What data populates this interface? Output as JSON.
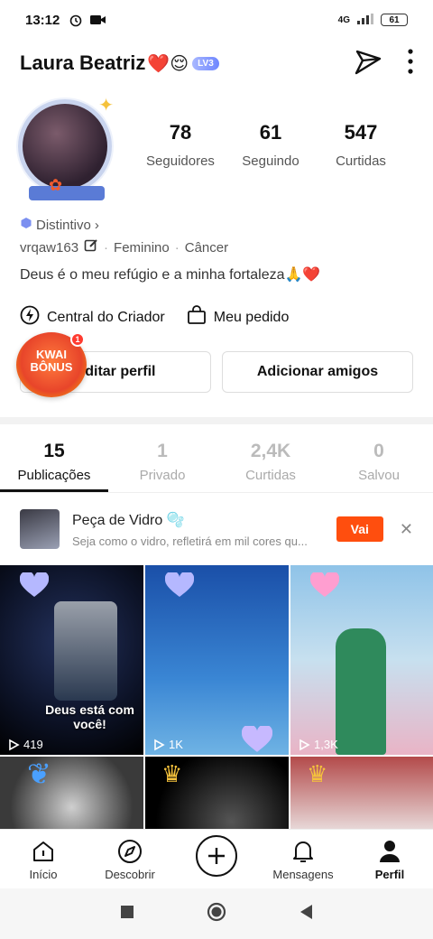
{
  "status": {
    "time": "13:12",
    "network": "4G",
    "battery": "61"
  },
  "header": {
    "name": "Laura Beatriz",
    "name_emoji": "❤️😌",
    "level": "LV3"
  },
  "stats": [
    {
      "value": "78",
      "label": "Seguidores"
    },
    {
      "value": "61",
      "label": "Seguindo"
    },
    {
      "value": "547",
      "label": "Curtidas"
    }
  ],
  "profile": {
    "badge_label": "Distintivo",
    "user_id": "vrqaw163",
    "gender": "Feminino",
    "sign": "Câncer",
    "bio": "Deus é o meu refúgio e a minha fortaleza🙏❤️"
  },
  "links": {
    "creator_center": "Central do Criador",
    "my_order": "Meu pedido"
  },
  "buttons": {
    "edit_profile": "Editar perfil",
    "add_friends": "Adicionar amigos"
  },
  "kwai_bonus": {
    "line1": "KWAI",
    "line2": "BÔNUS",
    "count": "1"
  },
  "tabs": [
    {
      "value": "15",
      "label": "Publicações"
    },
    {
      "value": "1",
      "label": "Privado"
    },
    {
      "value": "2,4K",
      "label": "Curtidas"
    },
    {
      "value": "0",
      "label": "Salvou"
    }
  ],
  "suggestion": {
    "title": "Peça de Vidro 🫧",
    "subtitle": "Seja como o vidro, refletirá em mil cores qu...",
    "action": "Vai"
  },
  "videos": [
    {
      "views": "419",
      "caption": "Deus está com você!"
    },
    {
      "views": "1K",
      "caption": ""
    },
    {
      "views": "1,3K",
      "caption": ""
    }
  ],
  "nav": [
    {
      "label": "Início"
    },
    {
      "label": "Descobrir"
    },
    {
      "label": ""
    },
    {
      "label": "Mensagens"
    },
    {
      "label": "Perfil"
    }
  ]
}
